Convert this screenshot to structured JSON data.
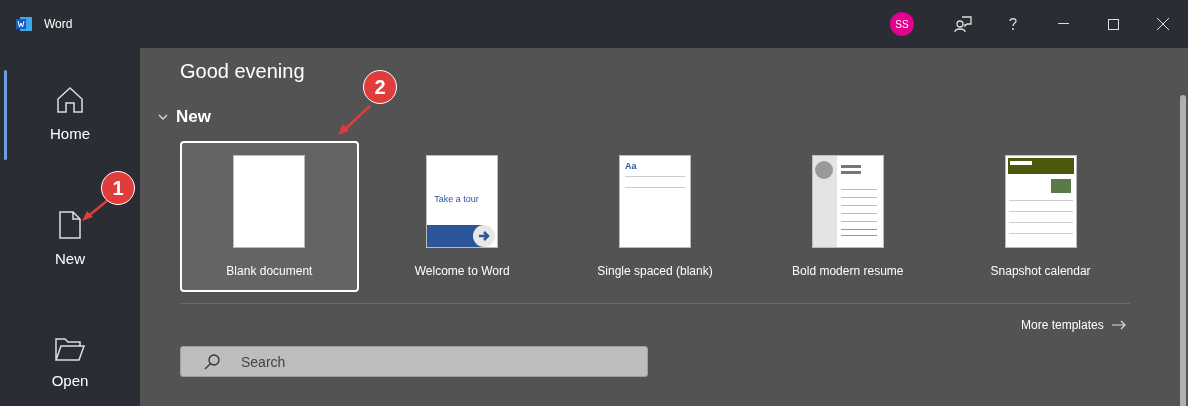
{
  "window": {
    "title": "Word",
    "account_initials": "SS"
  },
  "sidebar": {
    "items": [
      {
        "label": "Home",
        "selected": true
      },
      {
        "label": "New",
        "selected": false
      },
      {
        "label": "Open",
        "selected": false
      }
    ]
  },
  "greeting": "Good evening",
  "new_section": {
    "title": "New",
    "expanded": true,
    "templates": [
      {
        "label": "Blank document",
        "kind": "blank",
        "selected": true
      },
      {
        "label": "Welcome to Word",
        "kind": "tour",
        "selected": false,
        "thumb_text": "Take a tour"
      },
      {
        "label": "Single spaced (blank)",
        "kind": "single",
        "selected": false,
        "thumb_text": "Aa"
      },
      {
        "label": "Bold modern resume",
        "kind": "resume",
        "selected": false
      },
      {
        "label": "Snapshot calendar",
        "kind": "calendar",
        "selected": false
      }
    ],
    "more_link": "More templates"
  },
  "search": {
    "placeholder": "Search"
  },
  "annotations": [
    {
      "number": "1"
    },
    {
      "number": "2"
    }
  ]
}
